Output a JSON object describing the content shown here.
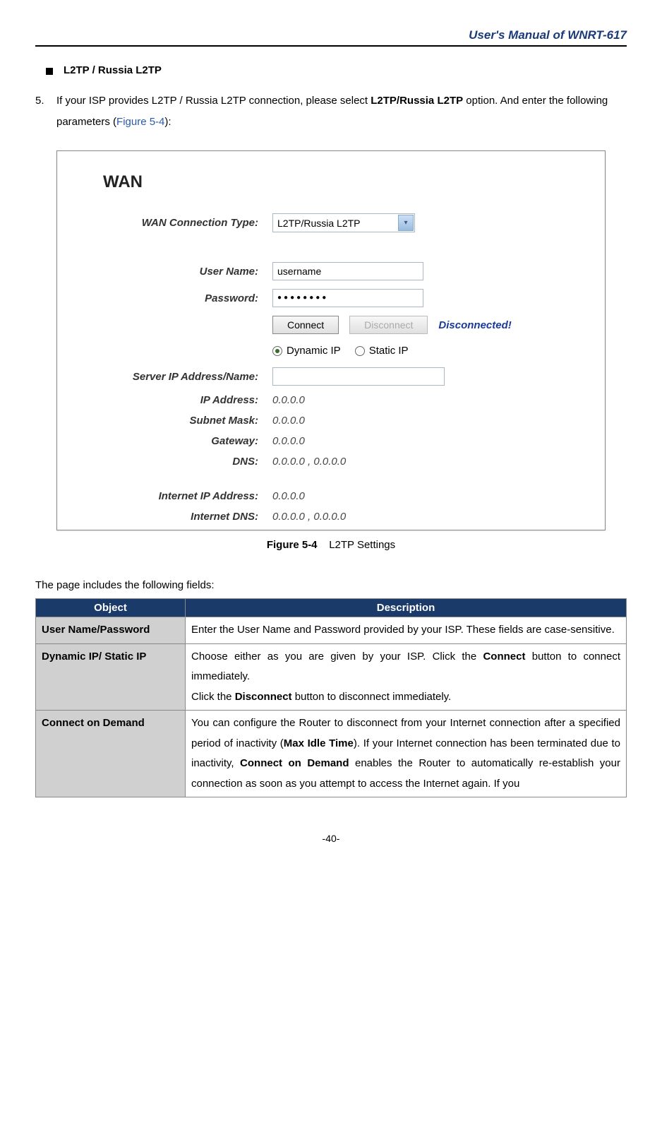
{
  "header_title": "User's Manual of WNRT-617",
  "section_title": "L2TP / Russia L2TP",
  "step_number": "5.",
  "step_text_1": "If your ISP provides L2TP / Russia L2TP connection, please select ",
  "step_bold_1": "L2TP/Russia L2TP",
  "step_text_2": " option. And enter the following parameters (",
  "step_link": "Figure 5-4",
  "step_text_3": "):",
  "wan": {
    "heading": "WAN",
    "labels": {
      "conn_type": "WAN Connection Type:",
      "user": "User Name:",
      "pass": "Password:",
      "server": "Server IP Address/Name:",
      "ip": "IP Address:",
      "subnet": "Subnet Mask:",
      "gateway": "Gateway:",
      "dns": "DNS:",
      "internet_ip": "Internet IP Address:",
      "internet_dns": "Internet DNS:"
    },
    "conn_type_value": "L2TP/Russia L2TP",
    "username": "username",
    "password_dots": "●●●●●●●●",
    "connect_btn": "Connect",
    "disconnect_btn": "Disconnect",
    "status": "Disconnected!",
    "radio_dynamic": "Dynamic IP",
    "radio_static": "Static IP",
    "server_value": "",
    "ip_value": "0.0.0.0",
    "subnet_value": "0.0.0.0",
    "gateway_value": "0.0.0.0",
    "dns_value": "0.0.0.0 , 0.0.0.0",
    "internet_ip_value": "0.0.0.0",
    "internet_dns_value": "0.0.0.0 , 0.0.0.0"
  },
  "caption_bold": "Figure 5-4",
  "caption_text": "L2TP Settings",
  "page_includes": "The page includes the following fields:",
  "table": {
    "headers": {
      "object": "Object",
      "description": "Description"
    },
    "rows": [
      {
        "obj": "User Name/Password",
        "desc": "Enter the User Name and Password provided by your ISP. These fields are case-sensitive."
      }
    ],
    "row2": {
      "obj": "Dynamic IP/ Static IP",
      "desc_1": "Choose either as you are given by your ISP. Click the ",
      "desc_b1": "Connect",
      "desc_2": " button to connect immediately.",
      "desc_3": "Click the ",
      "desc_b2": "Disconnect",
      "desc_4": " button to disconnect immediately."
    },
    "row3": {
      "obj": "Connect on Demand",
      "desc_1": "You can configure the Router to disconnect from your Internet connection after a specified period of inactivity (",
      "desc_b1": "Max Idle Time",
      "desc_2": "). If your Internet connection has been terminated due to inactivity, ",
      "desc_b2": "Connect on Demand",
      "desc_3": " enables the Router to automatically re-establish your connection as soon as you attempt to access the Internet again. If you"
    }
  },
  "page_number": "-40-"
}
